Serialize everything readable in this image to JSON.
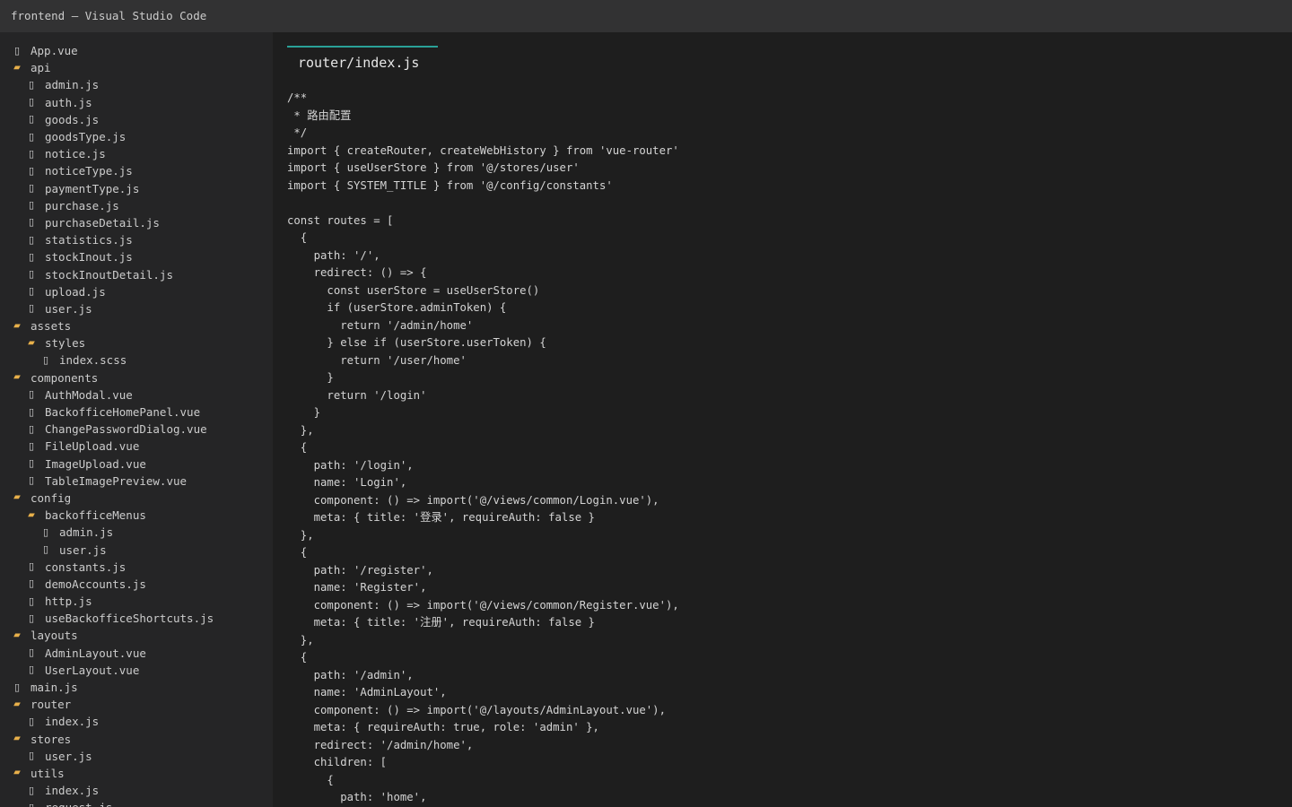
{
  "window": {
    "title": "frontend — Visual Studio Code"
  },
  "explorer": {
    "items": [
      {
        "label": "App.vue",
        "type": "file",
        "depth": 0
      },
      {
        "label": "api",
        "type": "folder",
        "depth": 0
      },
      {
        "label": "admin.js",
        "type": "file",
        "depth": 1
      },
      {
        "label": "auth.js",
        "type": "file",
        "depth": 1
      },
      {
        "label": "goods.js",
        "type": "file",
        "depth": 1
      },
      {
        "label": "goodsType.js",
        "type": "file",
        "depth": 1
      },
      {
        "label": "notice.js",
        "type": "file",
        "depth": 1
      },
      {
        "label": "noticeType.js",
        "type": "file",
        "depth": 1
      },
      {
        "label": "paymentType.js",
        "type": "file",
        "depth": 1
      },
      {
        "label": "purchase.js",
        "type": "file",
        "depth": 1
      },
      {
        "label": "purchaseDetail.js",
        "type": "file",
        "depth": 1
      },
      {
        "label": "statistics.js",
        "type": "file",
        "depth": 1
      },
      {
        "label": "stockInout.js",
        "type": "file",
        "depth": 1
      },
      {
        "label": "stockInoutDetail.js",
        "type": "file",
        "depth": 1
      },
      {
        "label": "upload.js",
        "type": "file",
        "depth": 1
      },
      {
        "label": "user.js",
        "type": "file",
        "depth": 1
      },
      {
        "label": "assets",
        "type": "folder",
        "depth": 0
      },
      {
        "label": "styles",
        "type": "folder",
        "depth": 1
      },
      {
        "label": "index.scss",
        "type": "file",
        "depth": 2
      },
      {
        "label": "components",
        "type": "folder",
        "depth": 0
      },
      {
        "label": "AuthModal.vue",
        "type": "file",
        "depth": 1
      },
      {
        "label": "BackofficeHomePanel.vue",
        "type": "file",
        "depth": 1
      },
      {
        "label": "ChangePasswordDialog.vue",
        "type": "file",
        "depth": 1
      },
      {
        "label": "FileUpload.vue",
        "type": "file",
        "depth": 1
      },
      {
        "label": "ImageUpload.vue",
        "type": "file",
        "depth": 1
      },
      {
        "label": "TableImagePreview.vue",
        "type": "file",
        "depth": 1
      },
      {
        "label": "config",
        "type": "folder",
        "depth": 0
      },
      {
        "label": "backofficeMenus",
        "type": "folder",
        "depth": 1
      },
      {
        "label": "admin.js",
        "type": "file",
        "depth": 2
      },
      {
        "label": "user.js",
        "type": "file",
        "depth": 2
      },
      {
        "label": "constants.js",
        "type": "file",
        "depth": 1
      },
      {
        "label": "demoAccounts.js",
        "type": "file",
        "depth": 1
      },
      {
        "label": "http.js",
        "type": "file",
        "depth": 1
      },
      {
        "label": "useBackofficeShortcuts.js",
        "type": "file",
        "depth": 1
      },
      {
        "label": "layouts",
        "type": "folder",
        "depth": 0
      },
      {
        "label": "AdminLayout.vue",
        "type": "file",
        "depth": 1
      },
      {
        "label": "UserLayout.vue",
        "type": "file",
        "depth": 1
      },
      {
        "label": "main.js",
        "type": "file",
        "depth": 0
      },
      {
        "label": "router",
        "type": "folder",
        "depth": 0
      },
      {
        "label": "index.js",
        "type": "file",
        "depth": 1
      },
      {
        "label": "stores",
        "type": "folder",
        "depth": 0
      },
      {
        "label": "user.js",
        "type": "file",
        "depth": 1
      },
      {
        "label": "utils",
        "type": "folder",
        "depth": 0
      },
      {
        "label": "index.js",
        "type": "file",
        "depth": 1
      },
      {
        "label": "request.js",
        "type": "file",
        "depth": 1
      }
    ]
  },
  "editor": {
    "tab_label": "router/index.js",
    "active_tab_accent": "#2aa198",
    "lines": [
      "/**",
      " * 路由配置",
      " */",
      "import { createRouter, createWebHistory } from 'vue-router'",
      "import { useUserStore } from '@/stores/user'",
      "import { SYSTEM_TITLE } from '@/config/constants'",
      "",
      "const routes = [",
      "  {",
      "    path: '/',",
      "    redirect: () => {",
      "      const userStore = useUserStore()",
      "      if (userStore.adminToken) {",
      "        return '/admin/home'",
      "      } else if (userStore.userToken) {",
      "        return '/user/home'",
      "      }",
      "      return '/login'",
      "    }",
      "  },",
      "  {",
      "    path: '/login',",
      "    name: 'Login',",
      "    component: () => import('@/views/common/Login.vue'),",
      "    meta: { title: '登录', requireAuth: false }",
      "  },",
      "  {",
      "    path: '/register',",
      "    name: 'Register',",
      "    component: () => import('@/views/common/Register.vue'),",
      "    meta: { title: '注册', requireAuth: false }",
      "  },",
      "  {",
      "    path: '/admin',",
      "    name: 'AdminLayout',",
      "    component: () => import('@/layouts/AdminLayout.vue'),",
      "    meta: { requireAuth: true, role: 'admin' },",
      "    redirect: '/admin/home',",
      "    children: [",
      "      {",
      "        path: 'home',"
    ]
  },
  "icons": {
    "file": "file-icon",
    "folder": "folder-icon"
  },
  "colors": {
    "folder_icon": "#e8b04a",
    "file_icon": "#d4d4d4",
    "text": "#d4d4d4"
  }
}
